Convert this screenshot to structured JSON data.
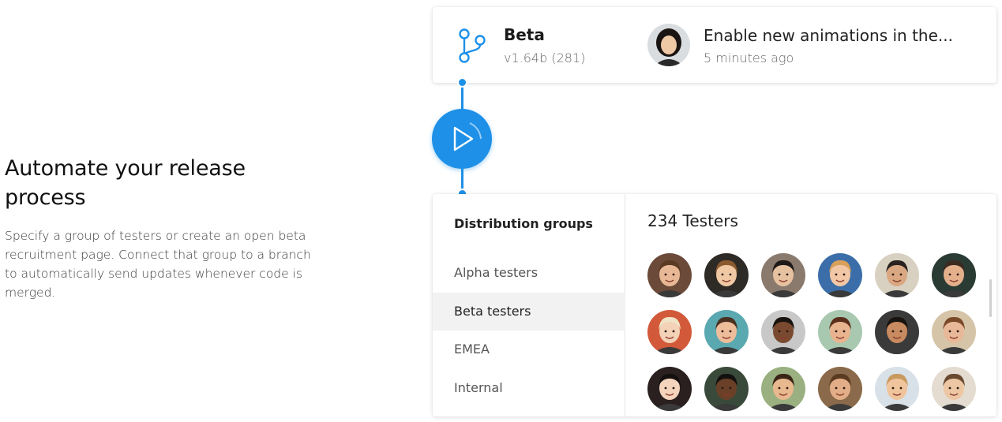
{
  "hero": {
    "title": "Automate your release process",
    "description": "Specify a group of testers or create an open beta recruitment page. Connect that group to a branch to automatically send updates whenever code is merged."
  },
  "branch": {
    "icon": "branch-icon",
    "name": "Beta",
    "version": "v1.64b (281)",
    "commit_message": "Enable new animations in the...",
    "commit_time": "5 minutes ago"
  },
  "pipeline": {
    "icon": "play-icon",
    "accent": "#1e90e8"
  },
  "distribution": {
    "title": "Distribution groups",
    "groups": [
      {
        "label": "Alpha testers",
        "active": false
      },
      {
        "label": "Beta testers",
        "active": true
      },
      {
        "label": "EMEA",
        "active": false
      },
      {
        "label": "Internal",
        "active": false
      }
    ],
    "testers_count": "234 Testers",
    "testers": [
      {
        "bg": "#6b4a3a",
        "skin": "#e8b896",
        "hair": "#5a3a22"
      },
      {
        "bg": "#2e2a26",
        "skin": "#f0c8a4",
        "hair": "#8a5a2e"
      },
      {
        "bg": "#8a7a6e",
        "skin": "#e7c2a0",
        "hair": "#1e1a18"
      },
      {
        "bg": "#3b6ea8",
        "skin": "#f2c7a5",
        "hair": "#d9a05a"
      },
      {
        "bg": "#d8d0c0",
        "skin": "#d9a882",
        "hair": "#2a2220"
      },
      {
        "bg": "#2a3b34",
        "skin": "#e4b08c",
        "hair": "#3a2a20"
      },
      {
        "bg": "#d25a3a",
        "skin": "#f3d2b8",
        "hair": "#f0e4c8"
      },
      {
        "bg": "#5aa8b0",
        "skin": "#eebd9a",
        "hair": "#4a3020"
      },
      {
        "bg": "#c8c8c8",
        "skin": "#7a4a30",
        "hair": "#1a1410"
      },
      {
        "bg": "#a8c8b0",
        "skin": "#e8b490",
        "hair": "#5a2e1a"
      },
      {
        "bg": "#3a3a3a",
        "skin": "#c88a60",
        "hair": "#1a1410"
      },
      {
        "bg": "#d6c4a8",
        "skin": "#e8b898",
        "hair": "#7a4a28"
      },
      {
        "bg": "#2a2020",
        "skin": "#f4d4bc",
        "hair": "#141010"
      },
      {
        "bg": "#3a4a3a",
        "skin": "#6a4028",
        "hair": "#141010"
      },
      {
        "bg": "#9ab080",
        "skin": "#e8b88e",
        "hair": "#3a2418"
      },
      {
        "bg": "#8a6a4a",
        "skin": "#e2ae88",
        "hair": "#5a3a20"
      },
      {
        "bg": "#d8e0e8",
        "skin": "#f0c49c",
        "hair": "#c89a60"
      },
      {
        "bg": "#e4dcd0",
        "skin": "#edc6a4",
        "hair": "#6a4a30"
      }
    ]
  }
}
